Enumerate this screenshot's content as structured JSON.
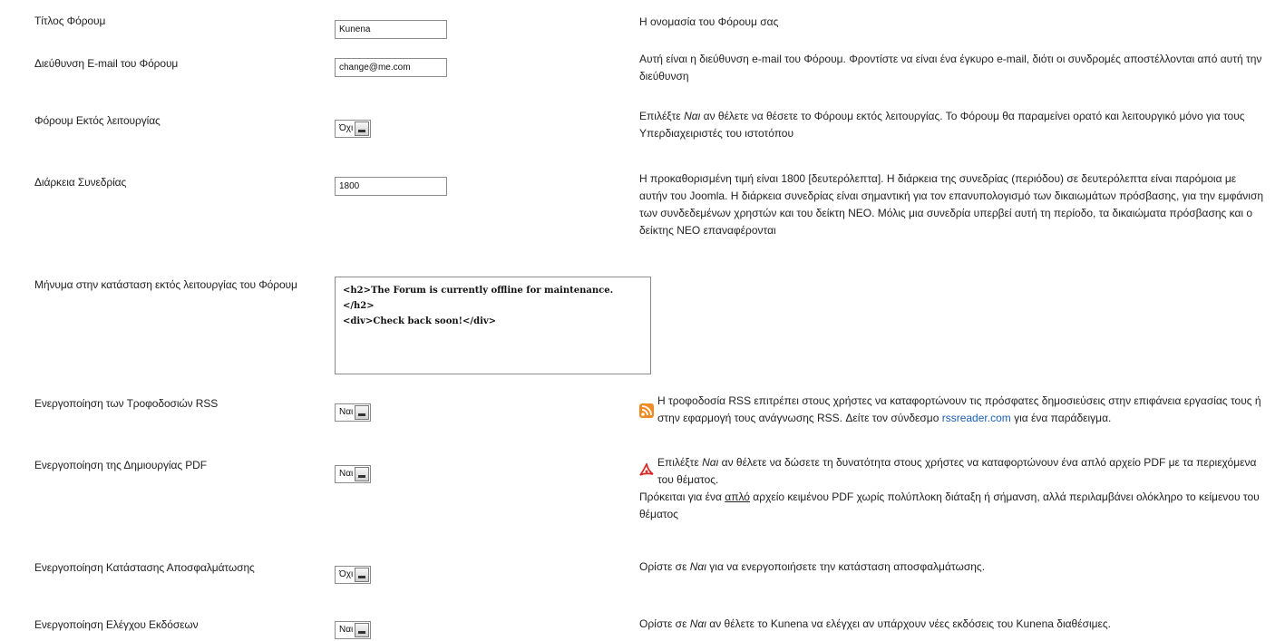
{
  "rows": {
    "forum_title": {
      "label": "Τίτλος Φόρουμ",
      "value": "Kunena",
      "desc": "Η ονομασία του Φόρουμ σας"
    },
    "forum_email": {
      "label": "Διεύθυνση E-mail του Φόρουμ",
      "value": "change@me.com",
      "desc": "Αυτή είναι η διεύθυνση e-mail του Φόρουμ. Φροντίστε να είναι ένα έγκυρο e-mail, διότι οι συνδρομές αποστέλλονται από αυτή την διεύθυνση"
    },
    "forum_offline": {
      "label": "Φόρουμ Εκτός λειτουργίας",
      "value": "Όχι",
      "desc_pre": "Επιλέξτε ",
      "desc_em": "Ναι",
      "desc_post": " αν θέλετε να θέσετε το Φόρουμ εκτός λειτουργίας. Το Φόρουμ θα παραμείνει ορατό και λειτουργικό μόνο για τους Υπερδιαχειριστές του ιστοτόπου"
    },
    "session_duration": {
      "label": "Διάρκεια Συνεδρίας",
      "value": "1800",
      "desc": "Η προκαθορισμένη τιμή είναι 1800 [δευτερόλεπτα]. Η διάρκεια της συνεδρίας (περιόδου) σε δευτερόλεπτα είναι παρόμοια με αυτήν του Joomla. Η διάρκεια συνεδρίας είναι σημαντική για τον επανυπολογισμό των δικαιωμάτων πρόσβασης, για την εμφάνιση των συνδεδεμένων χρηστών και του δείκτη ΝΕΟ. Μόλις μια συνεδρία υπερβεί αυτή τη περίοδο, τα δικαιώματα πρόσβασης και ο δείκτης ΝΕΟ επαναφέρονται"
    },
    "offline_message": {
      "label": "Μήνυμα στην κατάσταση εκτός λειτουργίας του Φόρουμ",
      "value": "<h2>The Forum is currently offline for maintenance.</h2>\n<div>Check back soon!</div>"
    },
    "enable_rss": {
      "label": "Ενεργοποίηση των Τροφοδοσιών RSS",
      "value": "Ναι",
      "icon": "rss-icon",
      "desc_pre": "Η τροφοδοσία RSS επιτρέπει στους χρήστες να καταφορτώνουν τις πρόσφατες δημοσιεύσεις στην επιφάνεια εργασίας τους ή στην εφαρμογή τους ανάγνωσης RSS. Δείτε τον σύνδεσμο ",
      "desc_link": "rssreader.com",
      "desc_post": " για ένα παράδειγμα."
    },
    "enable_pdf": {
      "label": "Ενεργοποίηση της Δημιουργίας PDF",
      "value": "Ναι",
      "icon": "pdf-icon",
      "desc_pre": "Επιλέξτε ",
      "desc_em": "Ναι",
      "desc_post": " αν θέλετε να δώσετε τη δυνατότητα στους χρήστες να καταφορτώνουν ένα απλό αρχείο PDF με τα περιεχόμενα του θέματος.",
      "desc2_pre": "Πρόκειται για ένα ",
      "desc2_u": "απλό",
      "desc2_post": " αρχείο κειμένου PDF χωρίς πολύπλοκη διάταξη ή σήμανση, αλλά περιλαμβάνει ολόκληρο το κείμενου του θέματος"
    },
    "debug_mode": {
      "label": "Ενεργοποίηση Κατάστασης Αποσφαλμάτωσης",
      "value": "Όχι",
      "desc_pre": "Ορίστε σε ",
      "desc_em": "Ναι",
      "desc_post": " για να ενεργοποιήσετε την κατάσταση αποσφαλμάτωσης."
    },
    "version_check": {
      "label": "Ενεργοποίηση Ελέγχου Εκδόσεων",
      "value": "Ναι",
      "desc_pre": "Ορίστε σε ",
      "desc_em": "Ναι",
      "desc_post": " αν θέλετε το Kunena να ελέγχει αν υπάρχουν νέες εκδόσεις του Kunena διαθέσιμες."
    }
  },
  "colors": {
    "rss_orange": "#f08a24",
    "pdf_red": "#d62b2b",
    "link_blue": "#1a5fb4"
  }
}
